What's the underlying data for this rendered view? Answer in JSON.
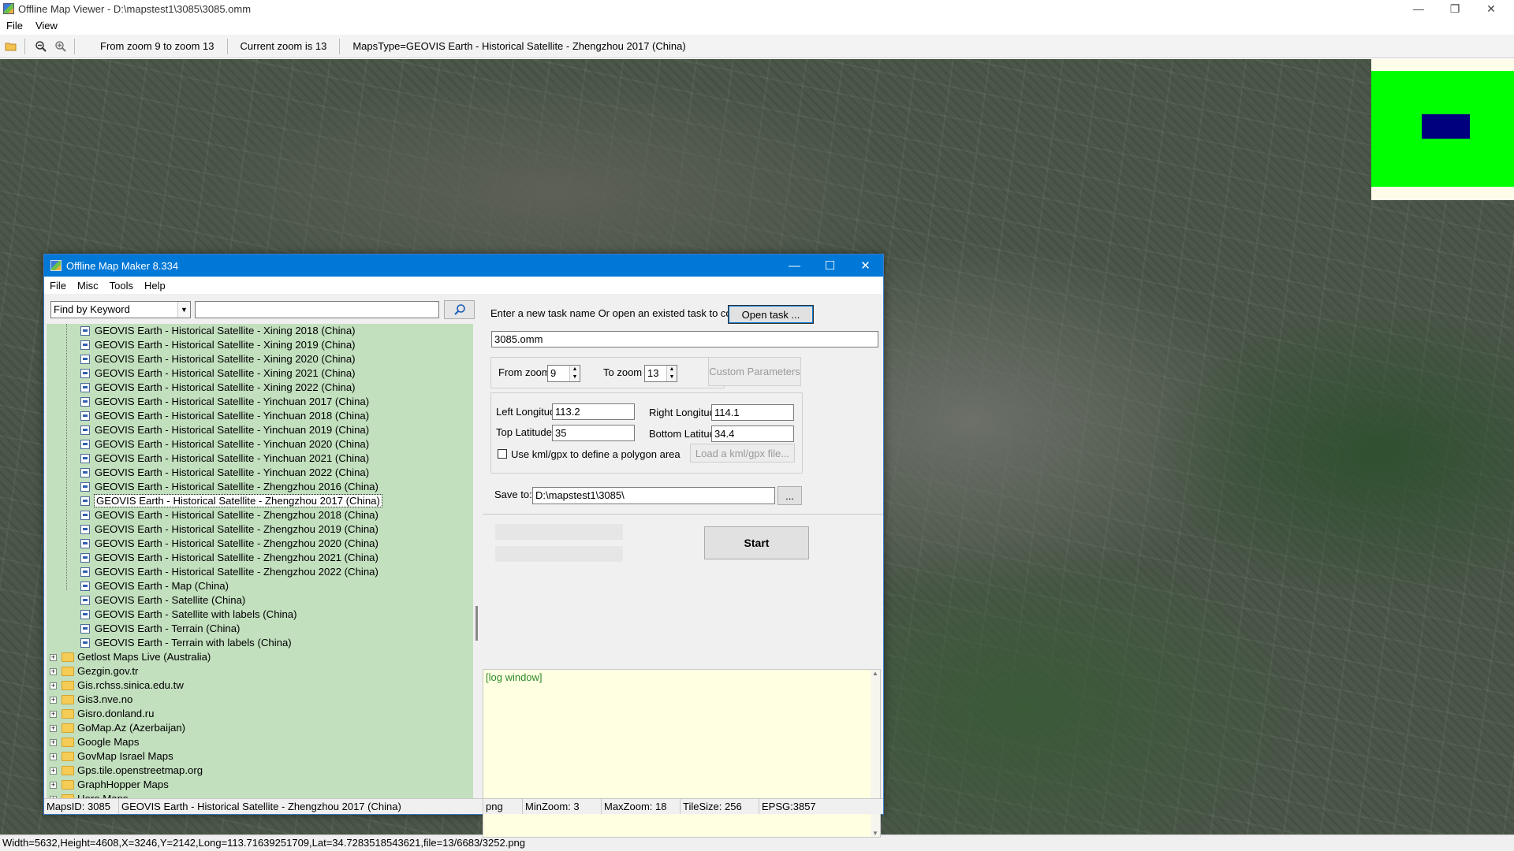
{
  "app": {
    "title": "Offline Map Viewer - D:\\mapstest1\\3085\\3085.omm",
    "menu": [
      "File",
      "View"
    ],
    "toolbar": {
      "zoom_range": "From zoom 9 to zoom 13",
      "current_zoom": "Current zoom is 13",
      "maps_type": "MapsType=GEOVIS Earth - Historical Satellite - Zhengzhou 2017 (China)"
    },
    "status": "Width=5632,Height=4608,X=3246,Y=2142,Long=113.71639251709,Lat=34.7283518543621,file=13/6683/3252.png",
    "minimap_colors": {
      "background": "#00ff00",
      "viewport": "#00007f"
    }
  },
  "dialog": {
    "title": "Offline Map Maker 8.334",
    "menu": [
      "File",
      "Misc",
      "Tools",
      "Help"
    ],
    "find_mode": "Find by Keyword",
    "find_value": "",
    "tree_items": [
      "GEOVIS Earth - Historical Satellite - Xining 2018 (China)",
      "GEOVIS Earth - Historical Satellite - Xining 2019 (China)",
      "GEOVIS Earth - Historical Satellite - Xining 2020 (China)",
      "GEOVIS Earth - Historical Satellite - Xining 2021 (China)",
      "GEOVIS Earth - Historical Satellite - Xining 2022 (China)",
      "GEOVIS Earth - Historical Satellite - Yinchuan 2017 (China)",
      "GEOVIS Earth - Historical Satellite - Yinchuan 2018 (China)",
      "GEOVIS Earth - Historical Satellite - Yinchuan 2019 (China)",
      "GEOVIS Earth - Historical Satellite - Yinchuan 2020 (China)",
      "GEOVIS Earth - Historical Satellite - Yinchuan 2021 (China)",
      "GEOVIS Earth - Historical Satellite - Yinchuan 2022 (China)",
      "GEOVIS Earth - Historical Satellite - Zhengzhou 2016 (China)",
      "GEOVIS Earth - Historical Satellite - Zhengzhou 2017 (China)",
      "GEOVIS Earth - Historical Satellite - Zhengzhou 2018 (China)",
      "GEOVIS Earth - Historical Satellite - Zhengzhou 2019 (China)",
      "GEOVIS Earth - Historical Satellite - Zhengzhou 2020 (China)",
      "GEOVIS Earth - Historical Satellite - Zhengzhou 2021 (China)",
      "GEOVIS Earth - Historical Satellite - Zhengzhou 2022 (China)",
      "GEOVIS Earth - Map (China)",
      "GEOVIS Earth - Satellite (China)",
      "GEOVIS Earth - Satellite with labels (China)",
      "GEOVIS Earth - Terrain (China)",
      "GEOVIS Earth - Terrain with labels (China)"
    ],
    "selected_tree_item": "GEOVIS Earth - Historical Satellite - Zhengzhou 2017 (China)",
    "tree_groups": [
      "Getlost Maps Live (Australia)",
      "Gezgin.gov.tr",
      "Gis.rchss.sinica.edu.tw",
      "Gis3.nve.no",
      "Gisro.donland.ru",
      "GoMap.Az (Azerbaijan)",
      "Google Maps",
      "GovMap Israel Maps",
      "Gps.tile.openstreetmap.org",
      "GraphHopper Maps",
      "Here Maps"
    ],
    "task_prompt": "Enter a new task name Or open an existed task to continue:",
    "open_task_label": "Open task ...",
    "task_name": "3085.omm",
    "from_zoom_label": "From zoom",
    "from_zoom": "9",
    "to_zoom_label": "To zoom",
    "to_zoom": "13",
    "custom_params_label": "Custom Parameters",
    "left_lon_label": "Left Longitude",
    "left_lon": "113.2",
    "right_lon_label": "Right Longitude",
    "right_lon": "114.1",
    "top_lat_label": "Top Latitude",
    "top_lat": "35",
    "bottom_lat_label": "Bottom Latitude",
    "bottom_lat": "34.4",
    "kml_label": "Use kml/gpx to define a polygon area",
    "load_kml_label": "Load a kml/gpx file...",
    "save_to_label": "Save to:",
    "save_to": "D:\\mapstest1\\3085\\",
    "browse_label": "...",
    "start_label": "Start",
    "log_title": "[log window]",
    "status": {
      "maps_id": "MapsID: 3085",
      "maps_name": "GEOVIS Earth - Historical Satellite - Zhengzhou 2017 (China)",
      "format": "png",
      "min_zoom": "MinZoom: 3",
      "max_zoom": "MaxZoom: 18",
      "tile_size": "TileSize: 256",
      "epsg": "EPSG:3857"
    }
  }
}
